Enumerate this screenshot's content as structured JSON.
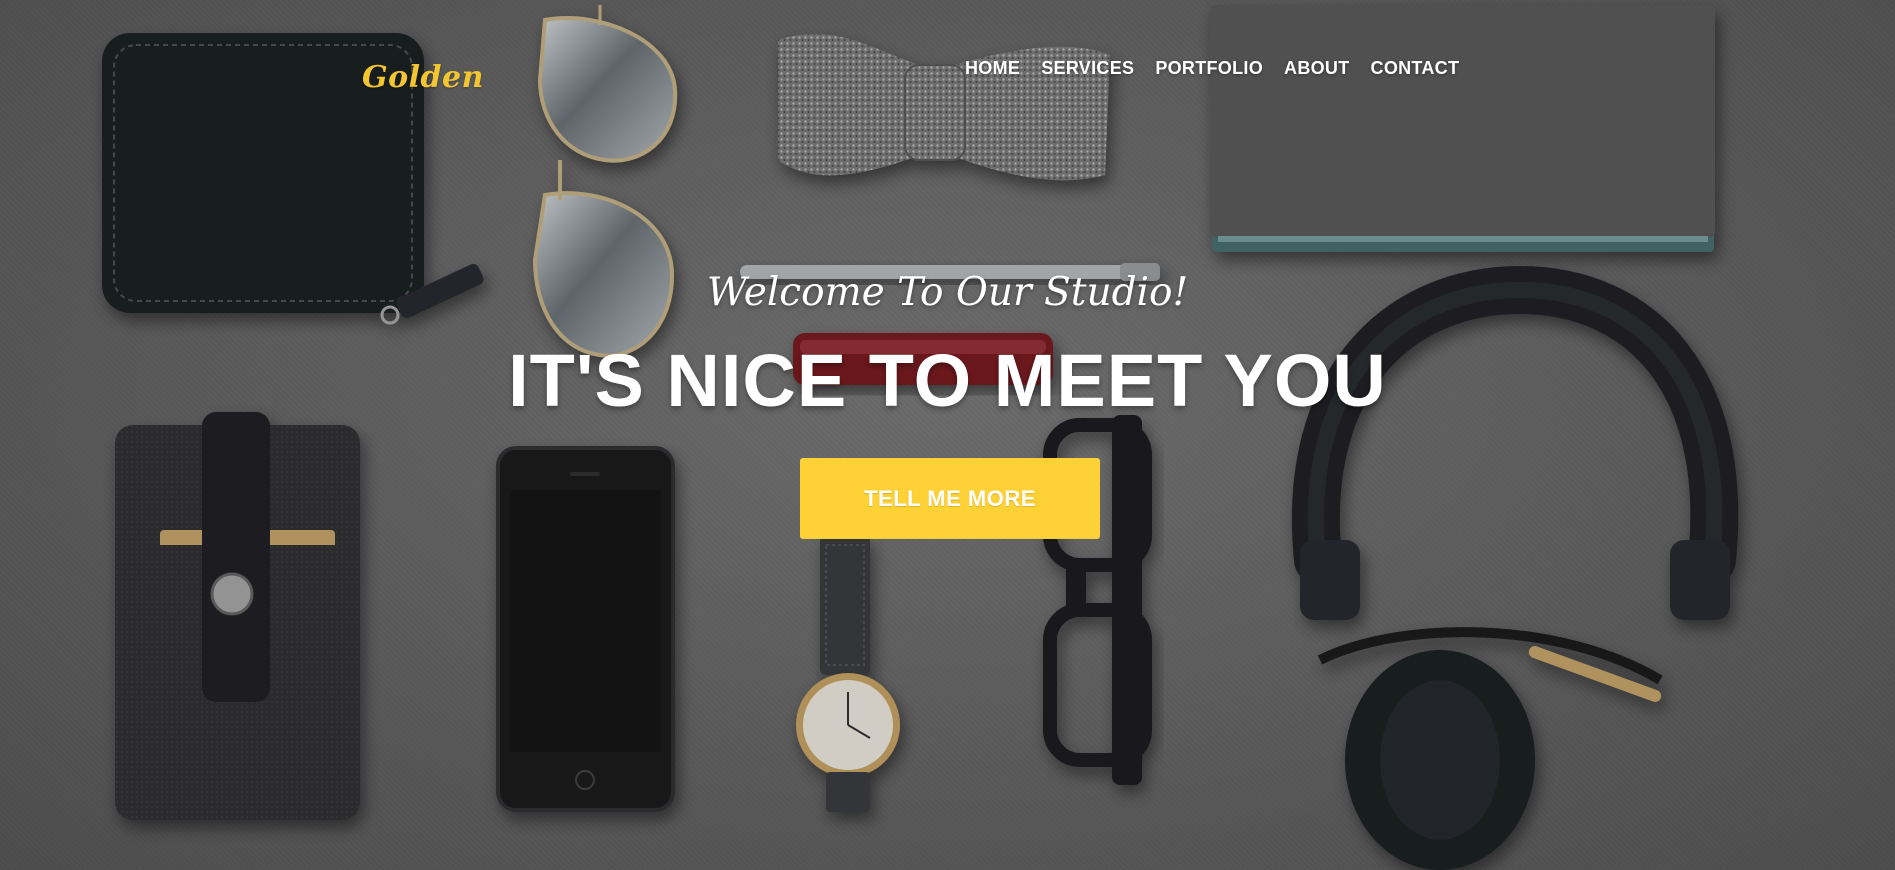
{
  "nav": {
    "brand": "Golden",
    "items": [
      {
        "label": "HOME"
      },
      {
        "label": "SERVICES"
      },
      {
        "label": "PORTFOLIO"
      },
      {
        "label": "ABOUT"
      },
      {
        "label": "CONTACT"
      }
    ]
  },
  "hero": {
    "subheading": "Welcome To Our Studio!",
    "heading": "IT'S NICE TO MEET YOU",
    "cta_label": "TELL ME MORE"
  },
  "colors": {
    "accent": "#fed136",
    "brand": "#f2c531",
    "background": "#6b6b6b",
    "text": "#ffffff"
  },
  "background_image_objects": [
    "wallet-icon",
    "aviator-sunglasses-icon",
    "bow-tie-icon",
    "notebook-icon",
    "pen-icon",
    "pocket-knife-icon",
    "felt-phone-case-icon",
    "smartphone-icon",
    "wristwatch-icon",
    "eyeglasses-icon",
    "headphones-icon"
  ]
}
